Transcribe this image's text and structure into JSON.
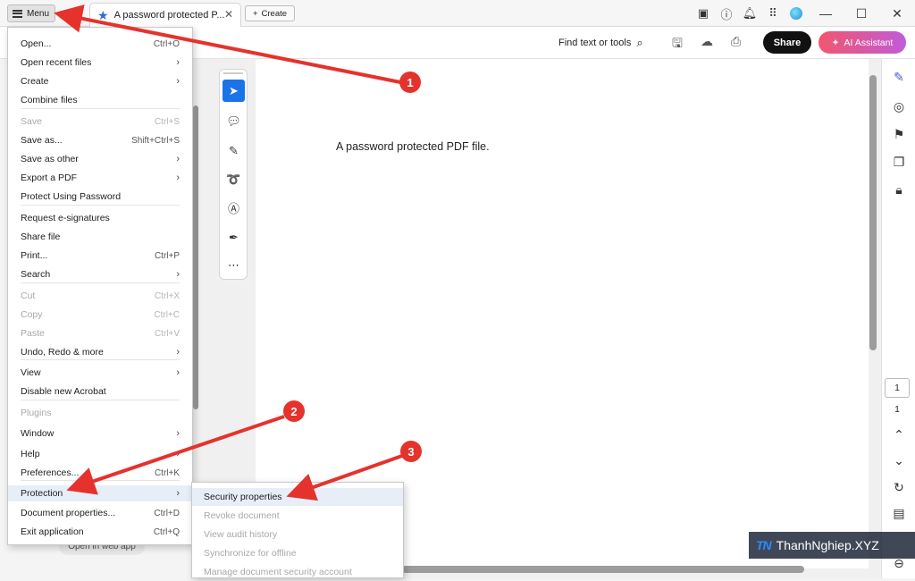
{
  "titlebar": {
    "menu_label": "Menu",
    "tab_title": "A password protected P...",
    "create_label": "Create"
  },
  "toolbar": {
    "find_label": "Find text or tools",
    "share_label": "Share",
    "ai_label": "AI Assistant"
  },
  "document": {
    "text": "A password protected PDF file."
  },
  "menu": {
    "items": [
      {
        "label": "Open...",
        "shortcut": "Ctrl+O",
        "disabled": false,
        "submenu": false
      },
      {
        "label": "Open recent files",
        "shortcut": "",
        "disabled": false,
        "submenu": true
      },
      {
        "label": "Create",
        "shortcut": "",
        "disabled": false,
        "submenu": true
      },
      {
        "label": "Combine files",
        "shortcut": "",
        "disabled": false,
        "submenu": false
      },
      {
        "label": "Save",
        "shortcut": "Ctrl+S",
        "disabled": true,
        "submenu": false
      },
      {
        "label": "Save as...",
        "shortcut": "Shift+Ctrl+S",
        "disabled": false,
        "submenu": false
      },
      {
        "label": "Save as other",
        "shortcut": "",
        "disabled": false,
        "submenu": true
      },
      {
        "label": "Export a PDF",
        "shortcut": "",
        "disabled": false,
        "submenu": true
      },
      {
        "label": "Protect Using Password",
        "shortcut": "",
        "disabled": false,
        "submenu": false
      },
      {
        "label": "Request e-signatures",
        "shortcut": "",
        "disabled": false,
        "submenu": false
      },
      {
        "label": "Share file",
        "shortcut": "",
        "disabled": false,
        "submenu": false
      },
      {
        "label": "Print...",
        "shortcut": "Ctrl+P",
        "disabled": false,
        "submenu": false
      },
      {
        "label": "Search",
        "shortcut": "",
        "disabled": false,
        "submenu": true
      },
      {
        "label": "Cut",
        "shortcut": "Ctrl+X",
        "disabled": true,
        "submenu": false
      },
      {
        "label": "Copy",
        "shortcut": "Ctrl+C",
        "disabled": true,
        "submenu": false
      },
      {
        "label": "Paste",
        "shortcut": "Ctrl+V",
        "disabled": true,
        "submenu": false
      },
      {
        "label": "Undo, Redo & more",
        "shortcut": "",
        "disabled": false,
        "submenu": true
      },
      {
        "label": "View",
        "shortcut": "",
        "disabled": false,
        "submenu": true
      },
      {
        "label": "Disable new Acrobat",
        "shortcut": "",
        "disabled": false,
        "submenu": false
      },
      {
        "label": "Plugins",
        "shortcut": "",
        "disabled": true,
        "submenu": false
      },
      {
        "label": "Window",
        "shortcut": "",
        "disabled": false,
        "submenu": true
      },
      {
        "label": "Help",
        "shortcut": "",
        "disabled": false,
        "submenu": true
      },
      {
        "label": "Preferences...",
        "shortcut": "Ctrl+K",
        "disabled": false,
        "submenu": false
      },
      {
        "label": "Protection",
        "shortcut": "",
        "disabled": false,
        "submenu": true,
        "highlighted": true
      },
      {
        "label": "Document properties...",
        "shortcut": "Ctrl+D",
        "disabled": false,
        "submenu": false
      },
      {
        "label": "Exit application",
        "shortcut": "Ctrl+Q",
        "disabled": false,
        "submenu": false
      }
    ]
  },
  "submenu": {
    "items": [
      {
        "label": "Security properties",
        "disabled": false
      },
      {
        "label": "Revoke document",
        "disabled": true
      },
      {
        "label": "View audit history",
        "disabled": true
      },
      {
        "label": "Synchronize for offline",
        "disabled": true
      },
      {
        "label": "Manage document security account",
        "disabled": true
      }
    ]
  },
  "open_web": "Open in web app",
  "page_nav": {
    "current": "1",
    "total": "1"
  },
  "annotations": [
    "1",
    "2",
    "3"
  ],
  "watermark": {
    "logo": "TN",
    "text": "ThanhNghiep.XYZ"
  },
  "colors": {
    "accent": "#1b73e8",
    "annotation": "#e5322d",
    "share": "#111111"
  }
}
